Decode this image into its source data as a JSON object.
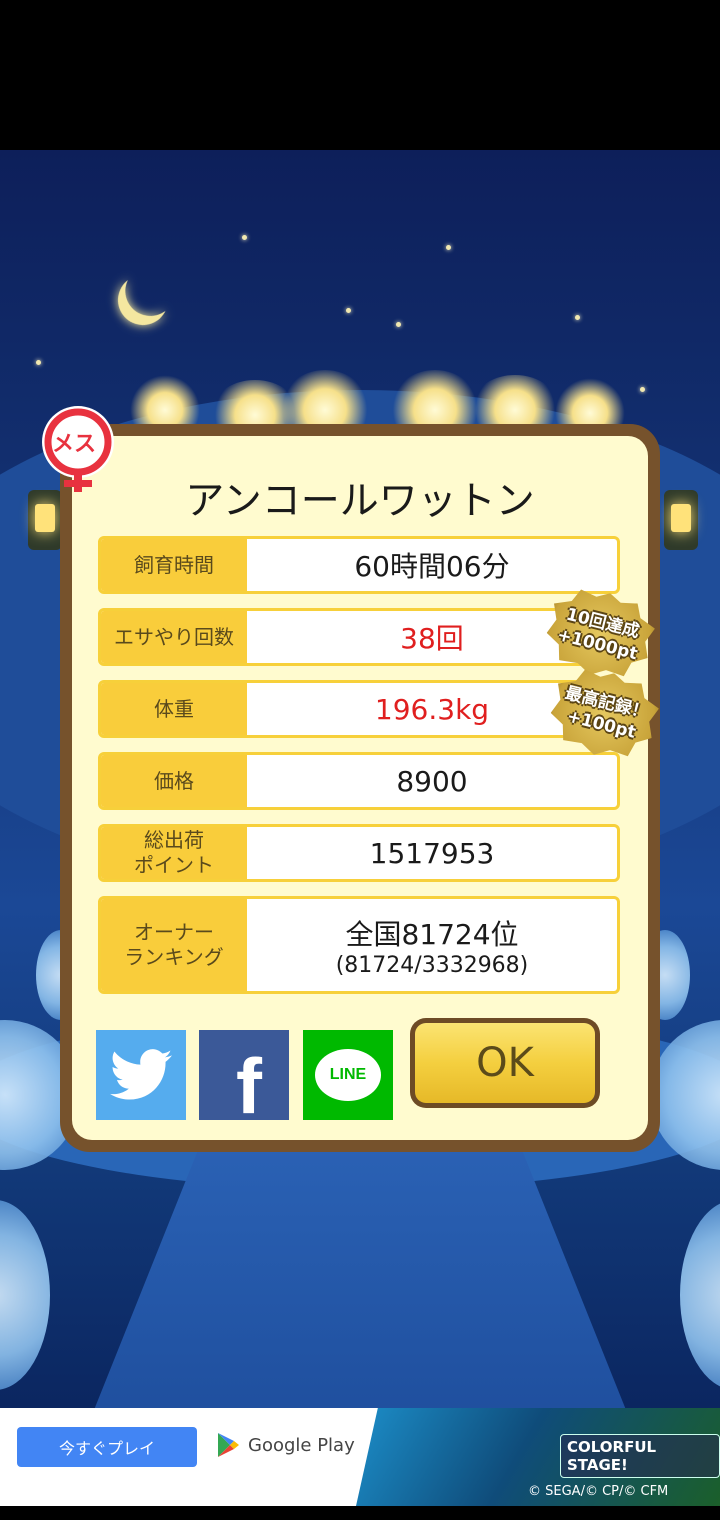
{
  "pet": {
    "name": "アンコールワットン",
    "gender_label": "メス"
  },
  "stats": [
    {
      "label": "飼育時間",
      "value": "60時間06分",
      "highlight": false
    },
    {
      "label": "エサやり回数",
      "value": "38回",
      "highlight": true
    },
    {
      "label": "体重",
      "value": "196.3kg",
      "highlight": true
    },
    {
      "label": "価格",
      "value": "8900",
      "highlight": false
    },
    {
      "label": "総出荷\nポイント",
      "value": "1517953",
      "highlight": false
    },
    {
      "label": "オーナー\nランキング",
      "value": "全国81724位",
      "sub": "(81724/3332968)",
      "highlight": false
    }
  ],
  "badges": [
    {
      "line1": "10回達成",
      "line2": "+1000pt"
    },
    {
      "line1": "最高記録！",
      "line2": "+100pt"
    }
  ],
  "share": [
    {
      "name": "twitter",
      "color": "#55acee"
    },
    {
      "name": "facebook",
      "color": "#3b5998",
      "glyph": "f"
    },
    {
      "name": "line",
      "color": "#00b900",
      "glyph": "LINE"
    }
  ],
  "ok_button": {
    "label": "OK"
  },
  "ad": {
    "cta": "今すぐプレイ",
    "store": "Google Play",
    "game_logo": "COLORFUL STAGE!",
    "copyright": "© SEGA/© CP/© CFM"
  },
  "colors": {
    "value_highlight": "#e01f1f",
    "label_bg": "#f9cd3b",
    "dialog_border": "#76522c",
    "panel_bg": "#fffbcf"
  }
}
